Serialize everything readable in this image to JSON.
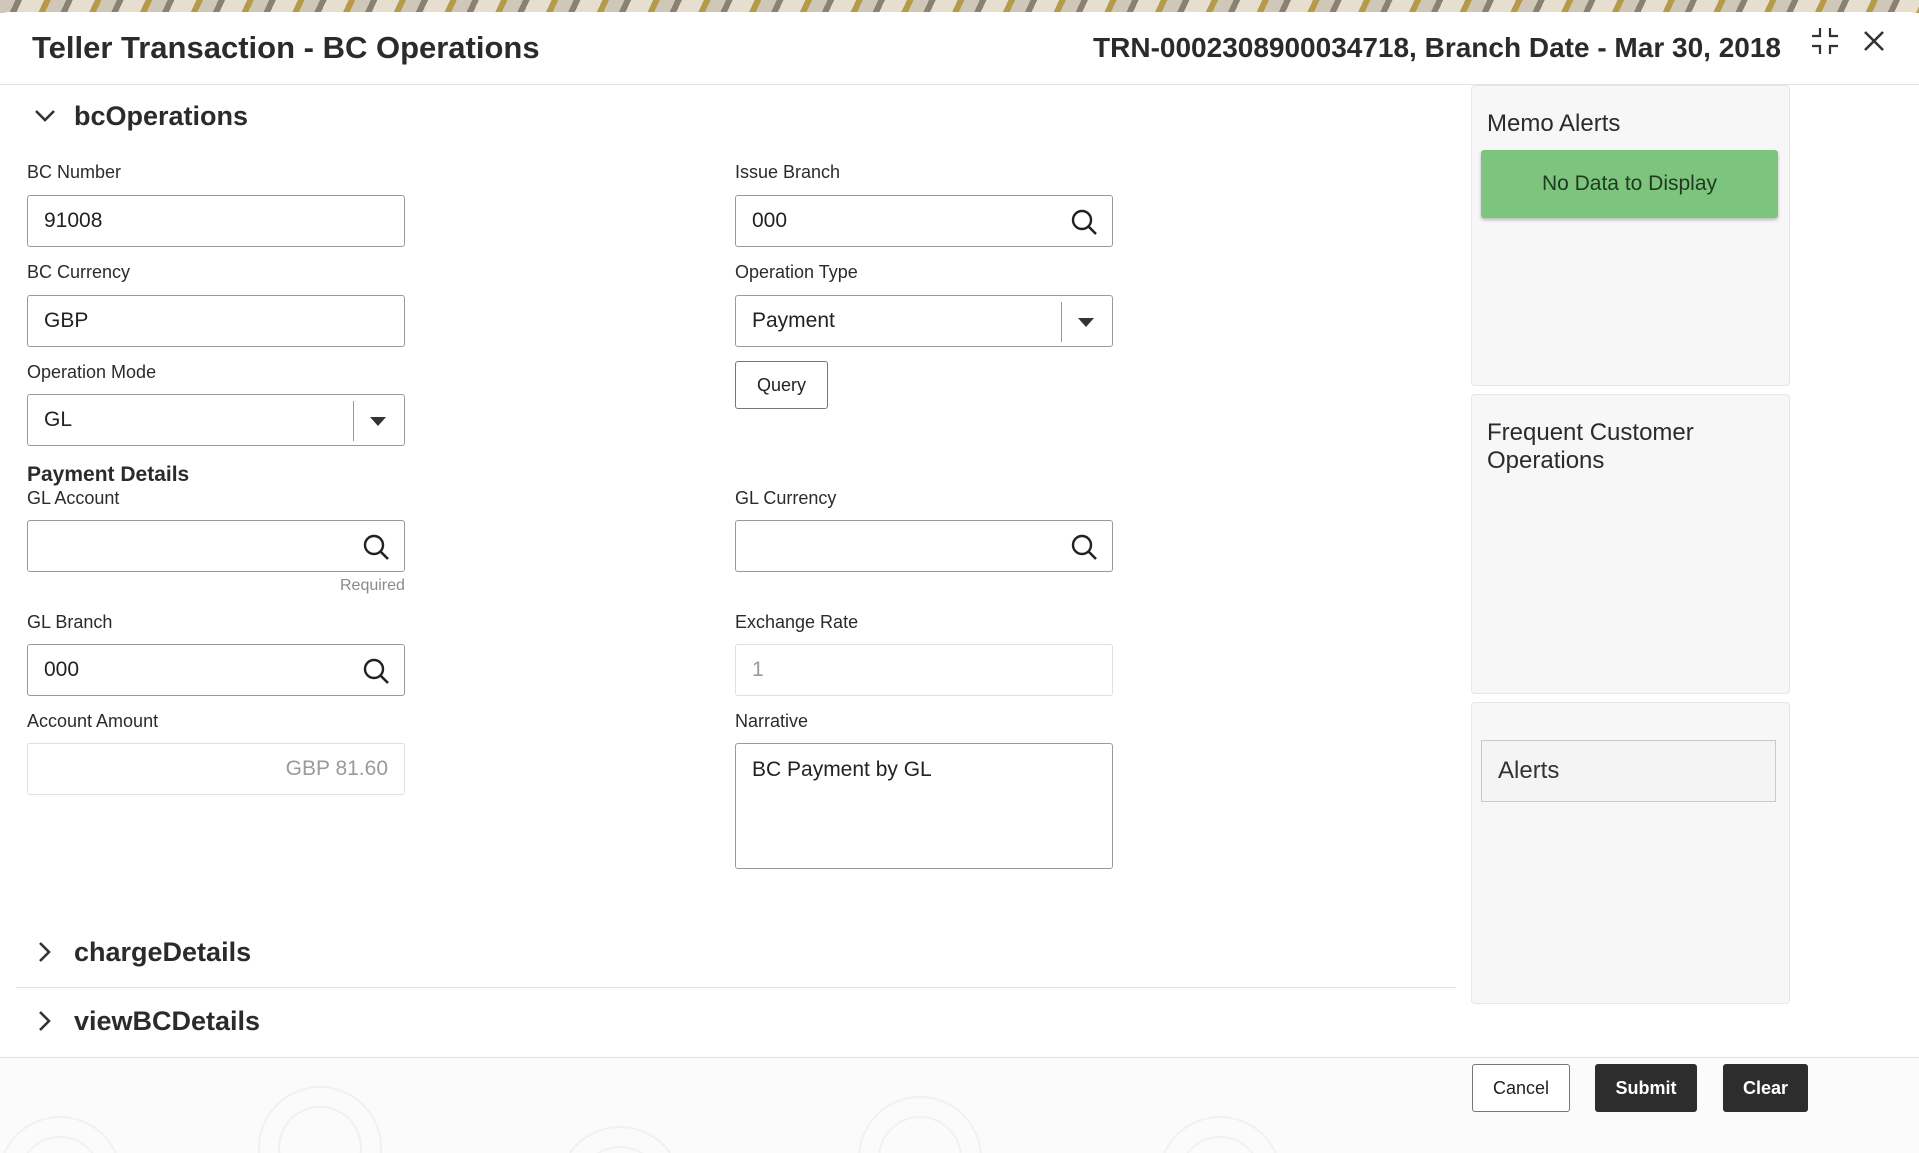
{
  "window": {
    "title": "Teller Transaction - BC Operations",
    "transaction_info": "TRN-0002308900034718, Branch Date - Mar 30, 2018"
  },
  "sections": {
    "bc_operations": "bcOperations",
    "charge_details": "chargeDetails",
    "view_bc_details": "viewBCDetails"
  },
  "form": {
    "bc_number": {
      "label": "BC Number",
      "value": "91008"
    },
    "issue_branch": {
      "label": "Issue Branch",
      "value": "000"
    },
    "bc_currency": {
      "label": "BC Currency",
      "value": "GBP"
    },
    "operation_type": {
      "label": "Operation Type",
      "value": "Payment"
    },
    "operation_mode": {
      "label": "Operation Mode",
      "value": "GL"
    },
    "query_button": "Query",
    "payment_details_heading": "Payment Details",
    "gl_account": {
      "label": "GL Account",
      "value": "",
      "hint": "Required"
    },
    "gl_currency": {
      "label": "GL Currency",
      "value": ""
    },
    "gl_branch": {
      "label": "GL Branch",
      "value": "000"
    },
    "exchange_rate": {
      "label": "Exchange Rate",
      "value": "1"
    },
    "account_amount": {
      "label": "Account Amount",
      "value": "GBP 81.60"
    },
    "narrative": {
      "label": "Narrative",
      "value": "BC Payment by GL"
    }
  },
  "side_panels": {
    "memo_alerts": {
      "title": "Memo Alerts",
      "empty_text": "No Data to Display"
    },
    "frequent_ops": {
      "title": "Frequent Customer Operations"
    },
    "alerts": {
      "label": "Alerts"
    }
  },
  "footer": {
    "cancel": "Cancel",
    "submit": "Submit",
    "clear": "Clear"
  },
  "colors": {
    "no_data_bg": "#7dc57e",
    "primary_button": "#2d2d2d"
  }
}
